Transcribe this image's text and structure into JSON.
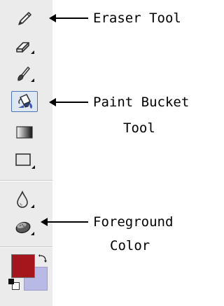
{
  "toolbar": {
    "tools": [
      {
        "name": "pencil-tool",
        "icon": "pencil-icon"
      },
      {
        "name": "eraser-tool",
        "icon": "eraser-icon"
      },
      {
        "name": "brush-tool",
        "icon": "brush-icon"
      },
      {
        "name": "paint-bucket-tool",
        "icon": "paint-bucket-icon",
        "selected": true
      },
      {
        "name": "gradient-tool",
        "icon": "gradient-icon"
      },
      {
        "name": "rectangle-tool",
        "icon": "rectangle-icon"
      },
      {
        "name": "blur-tool",
        "icon": "water-drop-icon"
      },
      {
        "name": "sponge-tool",
        "icon": "sponge-icon"
      }
    ],
    "colors": {
      "foreground": "#a5161c",
      "background": "#b9b9e6"
    }
  },
  "callouts": {
    "eraser": "Eraser Tool",
    "paint_bucket_line1": "Paint Bucket",
    "paint_bucket_line2": "Tool",
    "foreground_line1": "Foreground",
    "foreground_line2": "Color"
  }
}
